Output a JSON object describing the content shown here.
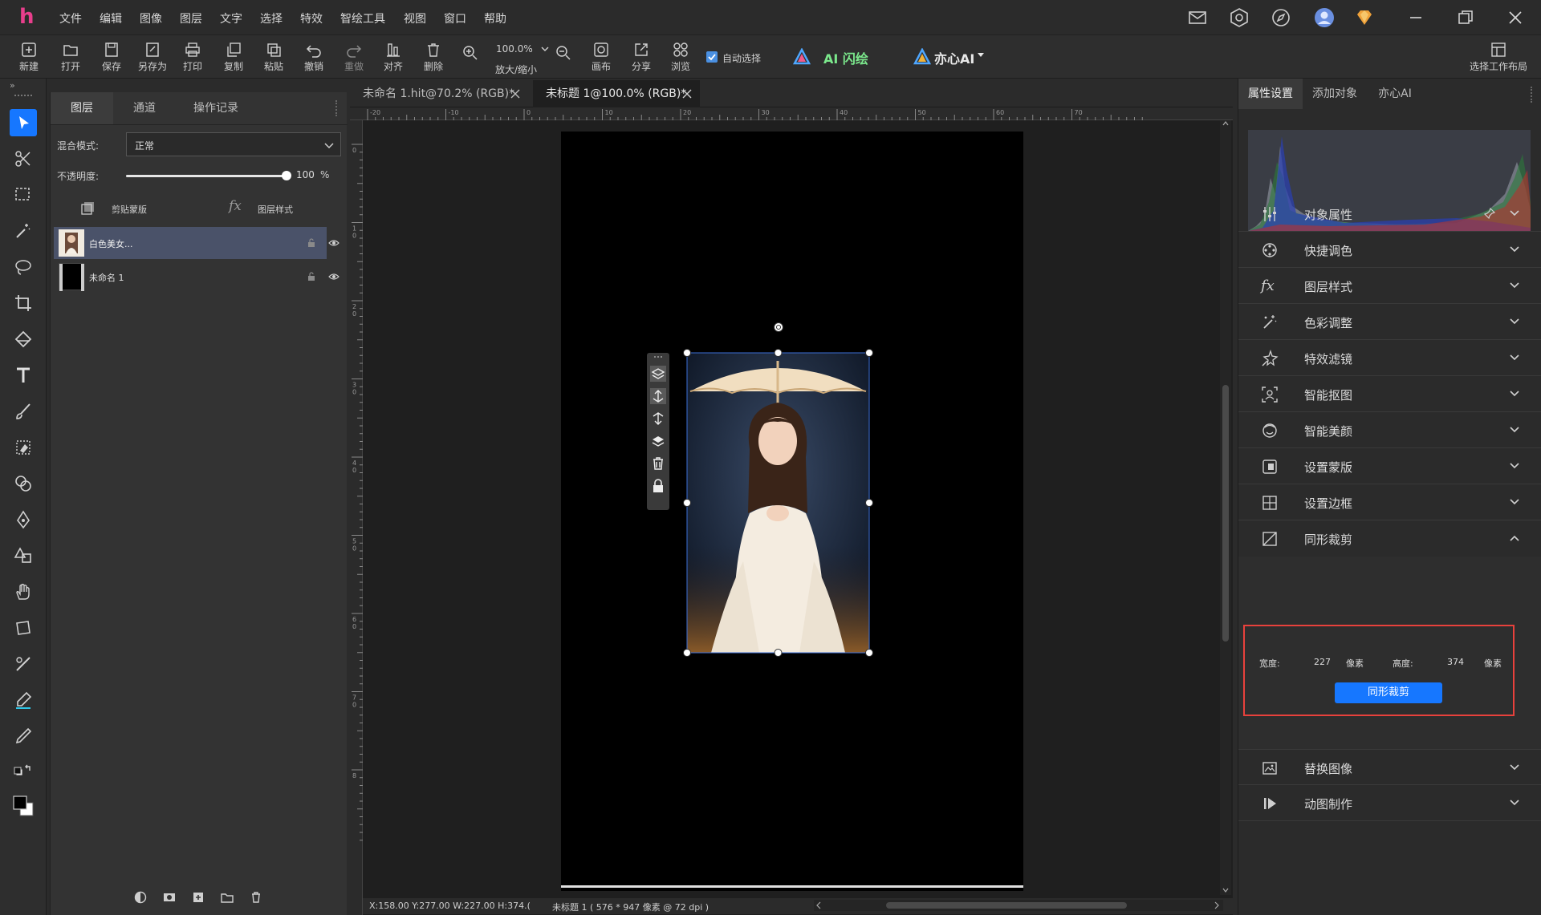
{
  "app": {
    "logo": "h",
    "accent": "#e83e8c",
    "selection_color": "#1677ff"
  },
  "menu": [
    "文件",
    "编辑",
    "图像",
    "图层",
    "文字",
    "选择",
    "特效",
    "智绘工具",
    "视图",
    "窗口",
    "帮助"
  ],
  "toolbar": {
    "new": "新建",
    "open": "打开",
    "save": "保存",
    "save_as": "另存为",
    "print": "打印",
    "copy": "复制",
    "paste": "粘贴",
    "undo": "撤销",
    "redo": "重做",
    "align": "对齐",
    "delete": "删除",
    "zoom_value": "100.0%",
    "zoom_label": "放大/缩小",
    "canvas": "画布",
    "share": "分享",
    "browse": "浏览",
    "auto_select": "自动选择",
    "ai_draw": "AI 闪绘",
    "yixin_ai": "亦心AI",
    "workspace": "选择工作布局"
  },
  "layers_panel": {
    "tabs": [
      "图层",
      "通道",
      "操作记录"
    ],
    "blend_label": "混合模式:",
    "blend_value": "正常",
    "opacity_label": "不透明度:",
    "opacity_value": "100",
    "opacity_unit": "%",
    "opacity_level": 1.0,
    "clip_mask": "剪贴蒙版",
    "fx": "fx",
    "layer_style": "图层样式",
    "layers": [
      {
        "name": "白色美女...",
        "selected": true
      },
      {
        "name": "未命名 1",
        "selected": false
      }
    ]
  },
  "documents": {
    "tabs": [
      {
        "title": "未命名 1.hit@70.2% (RGB)*",
        "active": false
      },
      {
        "title": "未标题 1@100.0% (RGB)*",
        "active": true
      }
    ],
    "ruler_h": [
      "-20",
      "-10",
      "0",
      "10",
      "20",
      "30",
      "40",
      "50",
      "60",
      "70"
    ],
    "ruler_v": [
      "0",
      "1 0",
      "2 0",
      "3 0",
      "4 0",
      "5 0",
      "6 0",
      "7 0",
      "8"
    ],
    "status_coords": "X:158.00 Y:277.00 W:227.00 H:374.(",
    "status_doc": "未标题 1 ( 576 * 947 像素 @ 72 dpi )"
  },
  "right_panel": {
    "tabs": [
      "属性设置",
      "添加对象",
      "亦心AI"
    ],
    "sections": [
      {
        "label": "对象属性",
        "icon": "sliders-icon"
      },
      {
        "label": "快捷调色",
        "icon": "palette-icon"
      },
      {
        "label": "图层样式",
        "icon": "fx-icon"
      },
      {
        "label": "色彩调整",
        "icon": "wand-icon"
      },
      {
        "label": "特效滤镜",
        "icon": "sparkle-icon"
      },
      {
        "label": "智能抠图",
        "icon": "cutout-icon"
      },
      {
        "label": "智能美颜",
        "icon": "face-icon"
      },
      {
        "label": "设置蒙版",
        "icon": "mask-icon"
      },
      {
        "label": "设置边框",
        "icon": "border-icon"
      },
      {
        "label": "同形裁剪",
        "icon": "crop-icon"
      }
    ],
    "crop": {
      "width_label": "宽度:",
      "width_value": "227",
      "height_label": "高度:",
      "height_value": "374",
      "unit": "像素",
      "button": "同形裁剪"
    },
    "bottom_sections": [
      {
        "label": "替换图像",
        "icon": "replace-image-icon"
      },
      {
        "label": "动图制作",
        "icon": "animation-icon"
      }
    ]
  }
}
